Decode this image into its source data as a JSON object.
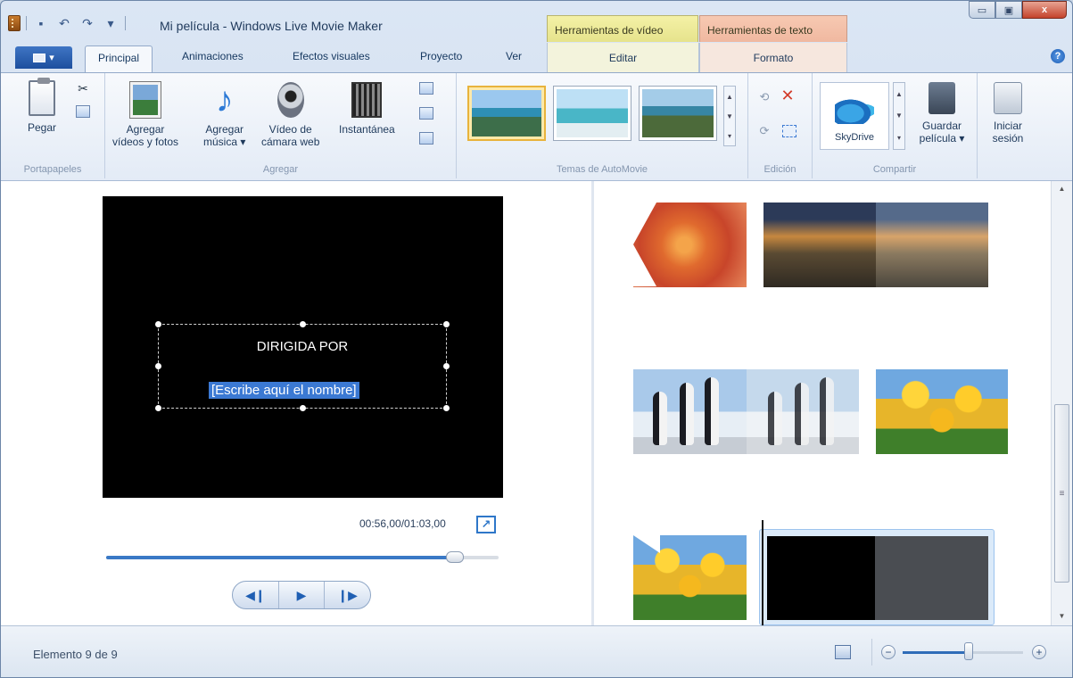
{
  "window": {
    "title": "Mi película - Windows Live Movie Maker",
    "contextual_tabs": {
      "video_tools": "Herramientas de vídeo",
      "text_tools": "Herramientas de texto"
    },
    "controls": {
      "minimize": "▭",
      "maximize": "▣",
      "close": "x"
    }
  },
  "quick_access": {
    "save": "▪",
    "undo": "↶",
    "redo": "↷",
    "customize": "▾"
  },
  "ribbon_tabs": {
    "file_menu": "▾",
    "items": [
      "Principal",
      "Animaciones",
      "Efectos visuales",
      "Proyecto",
      "Ver"
    ],
    "active": "Principal",
    "contextual": {
      "edit": "Editar",
      "format": "Formato"
    },
    "help": "?"
  },
  "ribbon": {
    "clipboard": {
      "paste": "Pegar",
      "group": "Portapapeles"
    },
    "add": {
      "videos_photos": [
        "Agregar",
        "vídeos y fotos"
      ],
      "music": [
        "Agregar",
        "música ▾"
      ],
      "webcam": [
        "Vídeo de",
        "cámara web"
      ],
      "snapshot": "Instantánea",
      "group": "Agregar"
    },
    "themes": {
      "group": "Temas de AutoMovie"
    },
    "editing": {
      "group": "Edición"
    },
    "share": {
      "skydrive": "SkyDrive",
      "save_movie": [
        "Guardar",
        "película ▾"
      ],
      "group": "Compartir"
    },
    "signin": [
      "Iniciar",
      "sesión"
    ]
  },
  "preview": {
    "caption_title": "DIRIGIDA POR",
    "caption_name": "[Escribe aquí el nombre]",
    "timecode": "00:56,00/01:03,00",
    "progress": 0.889,
    "transport": {
      "prev": "◀❙",
      "play": "▶",
      "next": "❙▶"
    }
  },
  "storyboard": {
    "scroll_glyph": "≡"
  },
  "status": {
    "text": "Elemento 9 de 9",
    "zoom": 0.55,
    "zoom_minus": "−",
    "zoom_plus": "+"
  }
}
